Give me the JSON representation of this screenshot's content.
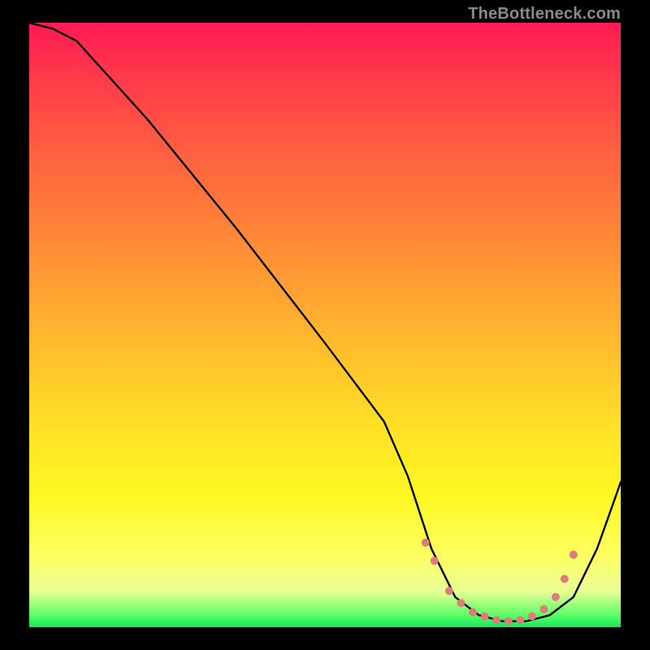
{
  "watermark": "TheBottleneck.com",
  "chart_data": {
    "type": "line",
    "title": "",
    "xlabel": "",
    "ylabel": "",
    "xlim": [
      0,
      100
    ],
    "ylim": [
      0,
      100
    ],
    "grid": false,
    "series": [
      {
        "name": "bottleneck-curve",
        "x": [
          0,
          4,
          8,
          20,
          35,
          50,
          60,
          64,
          68,
          72,
          76,
          80,
          84,
          88,
          92,
          96,
          100
        ],
        "y": [
          100,
          99,
          97,
          84,
          66,
          47,
          34,
          25,
          13,
          5,
          2,
          1,
          1,
          2,
          5,
          13,
          24
        ]
      }
    ],
    "markers": {
      "name": "valley-markers",
      "x": [
        67,
        68.5,
        71,
        73,
        75,
        77,
        79,
        81,
        83,
        85,
        87,
        89,
        90.5,
        92
      ],
      "y": [
        14,
        11,
        6,
        4,
        2.5,
        1.8,
        1.2,
        1.0,
        1.2,
        1.8,
        3,
        5,
        8,
        12
      ]
    },
    "colors": {
      "curve": "#000000",
      "marker": "#e07b7b",
      "background_top": "#ff1a53",
      "background_bottom": "#12e85e"
    }
  }
}
